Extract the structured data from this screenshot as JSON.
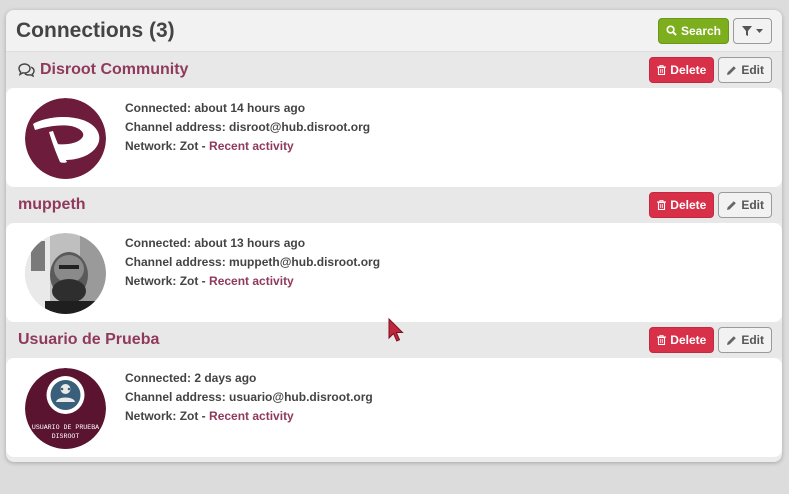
{
  "page": {
    "title": "Connections (3)",
    "search_label": "Search"
  },
  "connections": [
    {
      "name": "Disroot Community",
      "has_forum_icon": true,
      "delete_label": "Delete",
      "edit_label": "Edit",
      "connected_label": "Connected:",
      "connected_value": "about 14 hours ago",
      "address_label": "Channel address:",
      "address_value": "disroot@hub.disroot.org",
      "network_label": "Network:",
      "network_value": "Zot -",
      "activity_link": "Recent activity"
    },
    {
      "name": "muppeth",
      "delete_label": "Delete",
      "edit_label": "Edit",
      "connected_label": "Connected:",
      "connected_value": "about 13 hours ago",
      "address_label": "Channel address:",
      "address_value": "muppeth@hub.disroot.org",
      "network_label": "Network:",
      "network_value": "Zot -",
      "activity_link": "Recent activity"
    },
    {
      "name": "Usuario de Prueba",
      "delete_label": "Delete",
      "edit_label": "Edit",
      "connected_label": "Connected:",
      "connected_value": "2 days ago",
      "address_label": "Channel address:",
      "address_value": "usuario@hub.disroot.org",
      "network_label": "Network:",
      "network_value": "Zot -",
      "activity_link": "Recent activity",
      "avatar_text_1": "USUARIO DE PRUEBA",
      "avatar_text_2": "DISROOT"
    }
  ],
  "colors": {
    "accent": "#8f3a5c",
    "search_button": "#7dae1d",
    "delete_button": "#d9304a"
  },
  "icons": {
    "search": "search-icon",
    "filter": "filter-icon",
    "caret": "caret-down-icon",
    "forum": "comments-icon",
    "delete": "trash-icon",
    "edit": "pencil-icon"
  }
}
